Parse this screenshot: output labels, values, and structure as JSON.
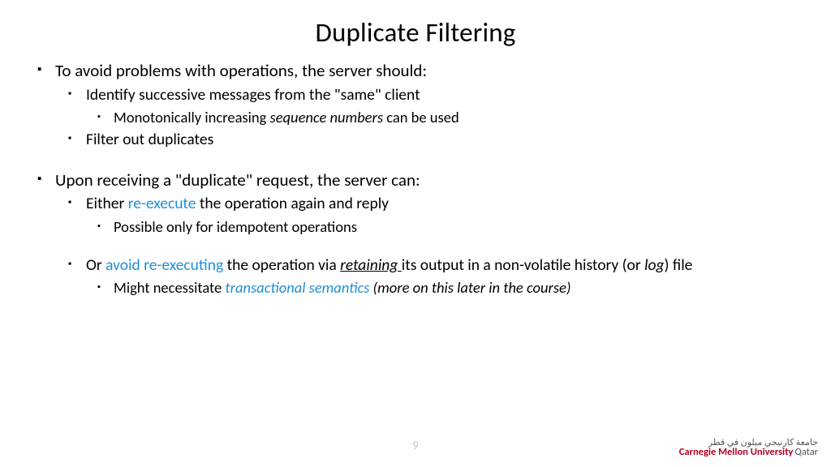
{
  "title": "Duplicate Filtering",
  "bullets": {
    "b1": "To avoid problems with operations, the server should:",
    "b1a": "Identify successive messages from the \"same\" client",
    "b1a1_pre": "Monotonically increasing ",
    "b1a1_it": "sequence numbers",
    "b1a1_post": " can be used",
    "b1b": "Filter out duplicates",
    "b2": "Upon receiving a \"duplicate\" request, the server can:",
    "b2a_pre": "Either ",
    "b2a_hl": "re-execute",
    "b2a_post": " the operation again and reply",
    "b2a1": "Possible only for idempotent operations",
    "b2b_pre": "Or ",
    "b2b_hl": "avoid re-executing",
    "b2b_mid1": " the operation via ",
    "b2b_ul": "retaining ",
    "b2b_mid2": "its output in a non-volatile history (or ",
    "b2b_it": "log",
    "b2b_post": ") file",
    "b2b1_pre": "Might necessitate ",
    "b2b1_hl": "transactional semantics",
    "b2b1_post": " (more on this later in the course)"
  },
  "pagenum": "9",
  "logo": {
    "arabic": "جامعة كارنيجي ميلون في قطر",
    "en1": "Carnegie Mellon University",
    "en2": "Qatar"
  }
}
